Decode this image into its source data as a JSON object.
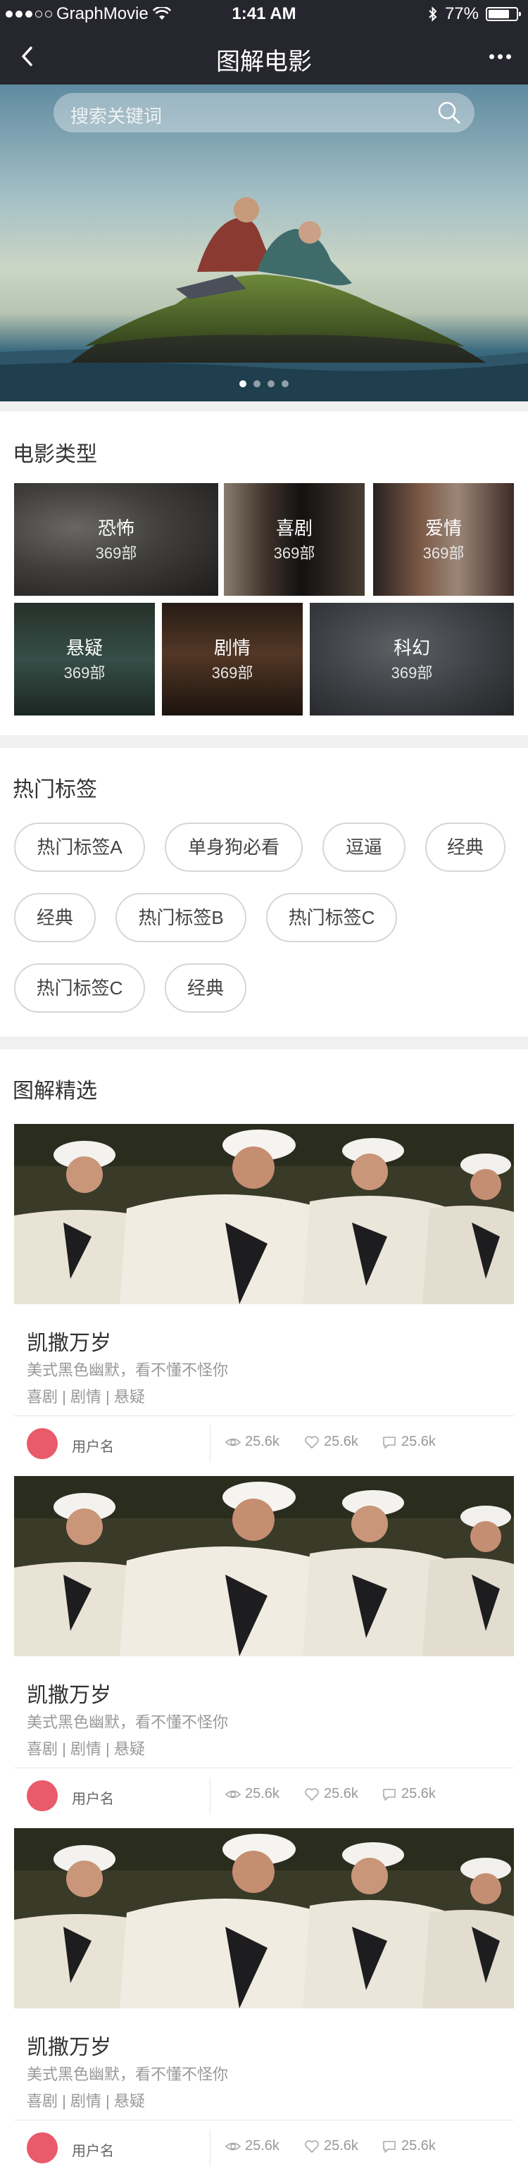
{
  "status": {
    "carrier": "GraphMovie",
    "time": "1:41 AM",
    "battery": "77%",
    "battery_level": 0.77
  },
  "nav": {
    "title": "图解电影"
  },
  "search": {
    "placeholder": "搜索关键词"
  },
  "banner": {
    "slides": 4,
    "active": 0
  },
  "categories": {
    "title": "电影类型",
    "items": [
      {
        "name": "恐怖",
        "count": "369部"
      },
      {
        "name": "喜剧",
        "count": "369部"
      },
      {
        "name": "爱情",
        "count": "369部"
      },
      {
        "name": "悬疑",
        "count": "369部"
      },
      {
        "name": "剧情",
        "count": "369部"
      },
      {
        "name": "科幻",
        "count": "369部"
      }
    ]
  },
  "hot_tags": {
    "title": "热门标签",
    "items": [
      "热门标签A",
      "单身狗必看",
      "逗逼",
      "经典",
      "经典",
      "热门标签B",
      "热门标签C",
      "热门标签C",
      "经典"
    ]
  },
  "featured": {
    "title": "图解精选",
    "cards": [
      {
        "title": "凯撒万岁",
        "desc": "美式黑色幽默，看不懂不怪你",
        "tags": "喜剧 | 剧情 | 悬疑",
        "user": "用户名",
        "views": "25.6k",
        "likes": "25.6k",
        "comments": "25.6k"
      },
      {
        "title": "凯撒万岁",
        "desc": "美式黑色幽默，看不懂不怪你",
        "tags": "喜剧 | 剧情 | 悬疑",
        "user": "用户名",
        "views": "25.6k",
        "likes": "25.6k",
        "comments": "25.6k"
      },
      {
        "title": "凯撒万岁",
        "desc": "美式黑色幽默，看不懂不怪你",
        "tags": "喜剧 | 剧情 | 悬疑",
        "user": "用户名",
        "views": "25.6k",
        "likes": "25.6k",
        "comments": "25.6k"
      }
    ]
  },
  "colors": {
    "bar": "#26262e",
    "avatar": "#e95a6a",
    "divider": "#f0f0f0"
  }
}
